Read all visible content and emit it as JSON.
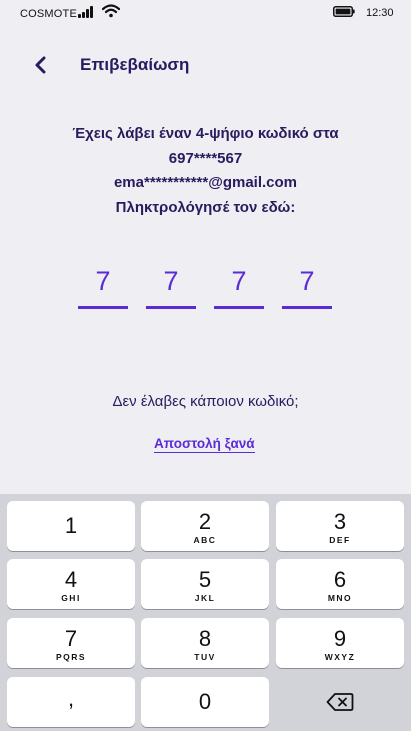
{
  "status_bar": {
    "carrier": "COSMOTE",
    "time": "12:30",
    "icons": [
      "signal-icon",
      "wifi-icon",
      "battery-icon"
    ]
  },
  "header": {
    "back_icon": "chevron-left-icon",
    "title": "Επιβεβαίωση"
  },
  "message": {
    "line1": "Έχεις λάβει έναν 4-ψήφιο κωδικό στα",
    "phone": "697****567",
    "email": "ema***********@gmail.com",
    "instruction": "Πληκτρολόγησέ τον εδώ:"
  },
  "code": {
    "digits": [
      "7",
      "7",
      "7",
      "7"
    ]
  },
  "resend": {
    "question": "Δεν έλαβες κάποιον κωδικό;",
    "link": "Αποστολή ξανά"
  },
  "keypad": {
    "keys": [
      {
        "digit": "1",
        "letters": ""
      },
      {
        "digit": "2",
        "letters": "ABC"
      },
      {
        "digit": "3",
        "letters": "DEF"
      },
      {
        "digit": "4",
        "letters": "GHI"
      },
      {
        "digit": "5",
        "letters": "JKL"
      },
      {
        "digit": "6",
        "letters": "MNO"
      },
      {
        "digit": "7",
        "letters": "PQRS"
      },
      {
        "digit": "8",
        "letters": "TUV"
      },
      {
        "digit": "9",
        "letters": "WXYZ"
      },
      {
        "digit": ",",
        "letters": ""
      },
      {
        "digit": "0",
        "letters": ""
      }
    ],
    "backspace_icon": "backspace-icon"
  },
  "colors": {
    "accent": "#5b2bd6",
    "text_dark": "#2a1a5e",
    "background": "#efeef3",
    "keyboard_bg": "#d2d3d8"
  }
}
